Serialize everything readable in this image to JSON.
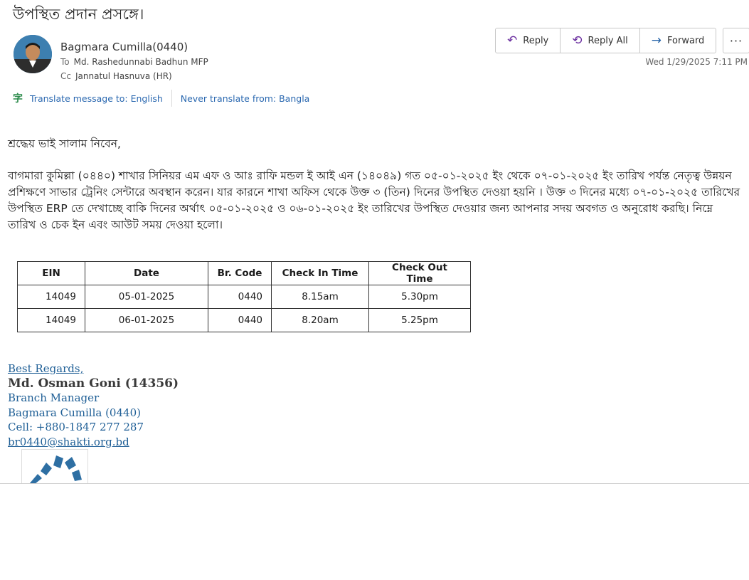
{
  "subject": "উপস্থিত প্রদান প্রসঙ্গে।",
  "sender": "Bagmara Cumilla(0440)",
  "to": {
    "label": "To",
    "value": "Md. Rashedunnabi Badhun MFP"
  },
  "cc": {
    "label": "Cc",
    "value": "Jannatul Hasnuva (HR)"
  },
  "toolbar": {
    "reply": "Reply",
    "reply_all": "Reply All",
    "forward": "Forward",
    "more": "···"
  },
  "datetime": "Wed 1/29/2025 7:11 PM",
  "translate": {
    "to": "Translate message to: English",
    "never": "Never translate from: Bangla"
  },
  "body": {
    "greeting": "শ্রদ্ধেয় ভাই সালাম নিবেন,",
    "paragraph": "বাগমারা কুমিল্লা (০৪৪০) শাখার সিনিয়র এম এফ ও আঃ রাফি মন্ডল ই আই এন (১৪০৪৯)  গত ০৫-০১-২০২৫ ইং থেকে ০৭-০১-২০২৫ ইং তারিখ পর্যন্ত নেতৃত্ব উন্নয়ন  প্রশিক্ষণে সাভার ট্রেনিং সেন্টারে অবস্থান করেন। যার  কারনে শাখা অফিস থেকে উক্ত ৩ (তিন) দিনের  উপস্থিত দেওয়া হয়নি । উক্ত ৩ দিনের মধ্যে ০৭-০১-২০২৫ তারিখের উপস্থিত ERP তে দেখাচ্ছে বাকি দিনের অর্থাৎ  ০৫-০১-২০২৫ ও ০৬-০১-২০২৫ ইং তারিখের উপস্থিত দেওয়ার জন্য আপনার সদয় অবগত ও অনুরোধ করছি। নিম্নে তারিখ ও চেক ইন এবং আউট  সময় দেওয়া হলো।"
  },
  "table": {
    "headers": [
      "EIN",
      "Date",
      "Br. Code",
      "Check In Time",
      "Check Out Time"
    ],
    "rows": [
      [
        "14049",
        "05-01-2025",
        "0440",
        "8.15am",
        "5.30pm"
      ],
      [
        "14049",
        "06-01-2025",
        "0440",
        "8.20am",
        "5.25pm"
      ]
    ]
  },
  "signature": {
    "regards": "Best Regards,",
    "name": "Md. Osman Goni (14356)",
    "title": "Branch Manager",
    "branch": "Bagmara Cumilla (0440)",
    "cell": "Cell: +880-1847 277 287",
    "email": "br0440@shakti.org.bd"
  },
  "colors": {
    "link": "#2a68b0",
    "accent": "#6b2fa0"
  }
}
